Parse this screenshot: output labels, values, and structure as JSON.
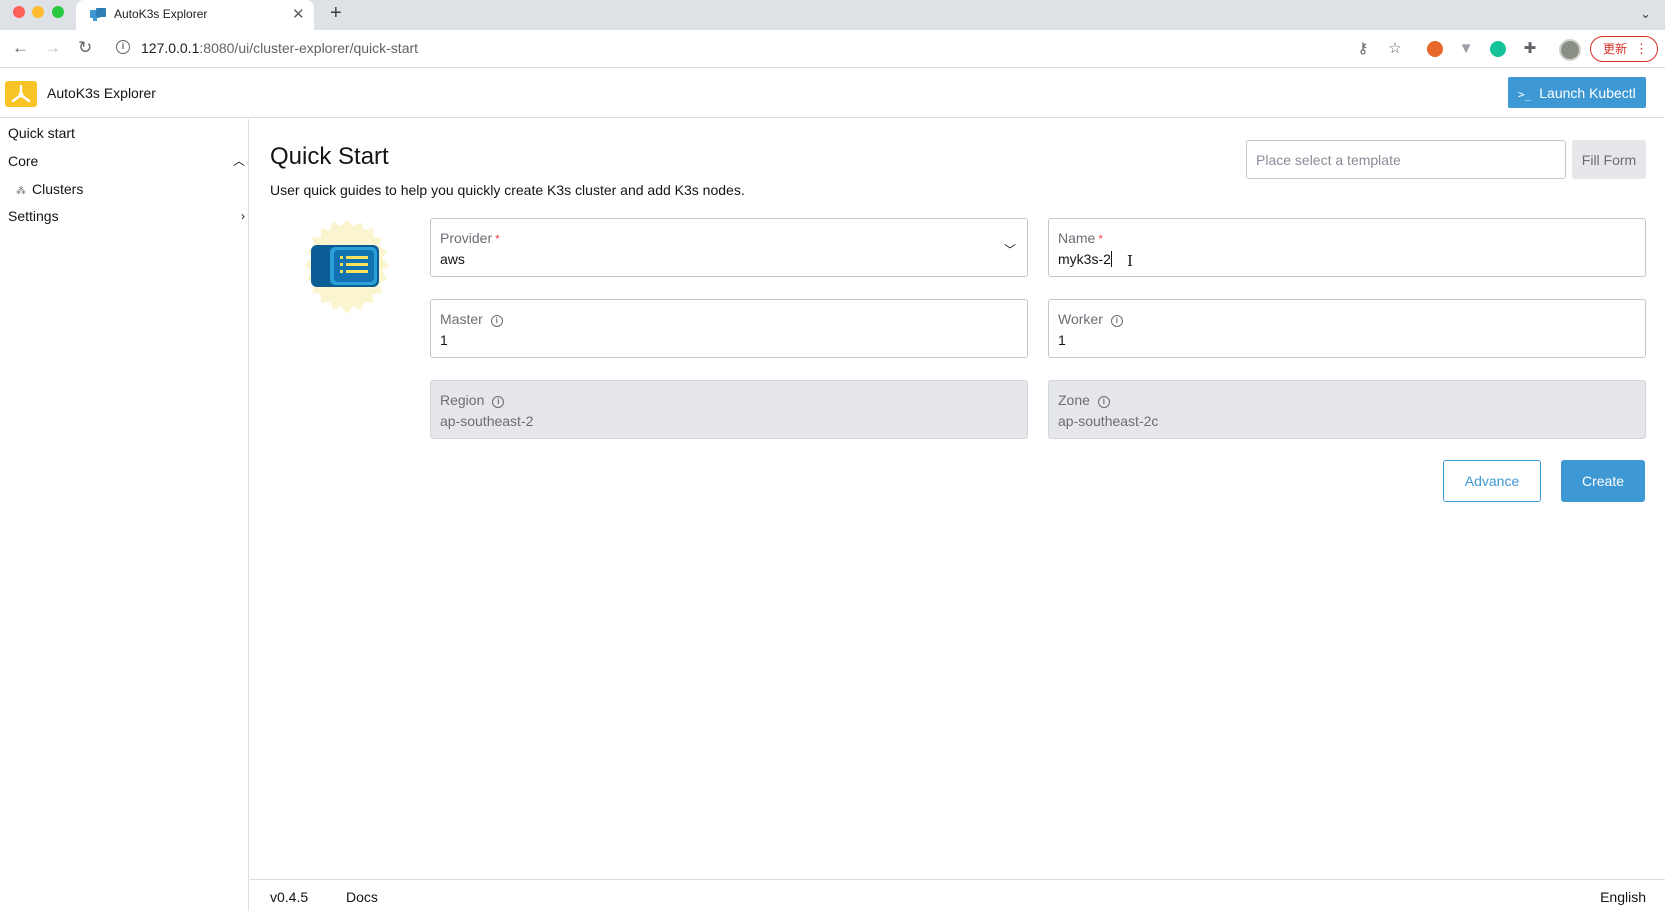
{
  "browser": {
    "tab_title": "AutoK3s Explorer",
    "url_host": "127.0.0.1",
    "url_rest": ":8080/ui/cluster-explorer/quick-start",
    "update_label": "更新"
  },
  "header": {
    "app_title": "AutoK3s Explorer",
    "kubectl_label": "Launch Kubectl"
  },
  "sidebar": {
    "quick_start": "Quick start",
    "core": "Core",
    "clusters": "Clusters",
    "settings": "Settings"
  },
  "page": {
    "title": "Quick Start",
    "description": "User quick guides to help you quickly create K3s cluster and add K3s nodes.",
    "template_placeholder": "Place select a template",
    "fill_form_label": "Fill Form"
  },
  "form": {
    "provider": {
      "label": "Provider",
      "value": "aws"
    },
    "name": {
      "label": "Name",
      "value": "myk3s-2"
    },
    "master": {
      "label": "Master",
      "value": "1"
    },
    "worker": {
      "label": "Worker",
      "value": "1"
    },
    "region": {
      "label": "Region",
      "value": "ap-southeast-2"
    },
    "zone": {
      "label": "Zone",
      "value": "ap-southeast-2c"
    },
    "advance_label": "Advance",
    "create_label": "Create"
  },
  "footer": {
    "version": "v0.4.5",
    "docs": "Docs",
    "language": "English"
  },
  "colors": {
    "primary": "#3d98d3",
    "logo": "#f7c325",
    "required": "#f64747"
  }
}
